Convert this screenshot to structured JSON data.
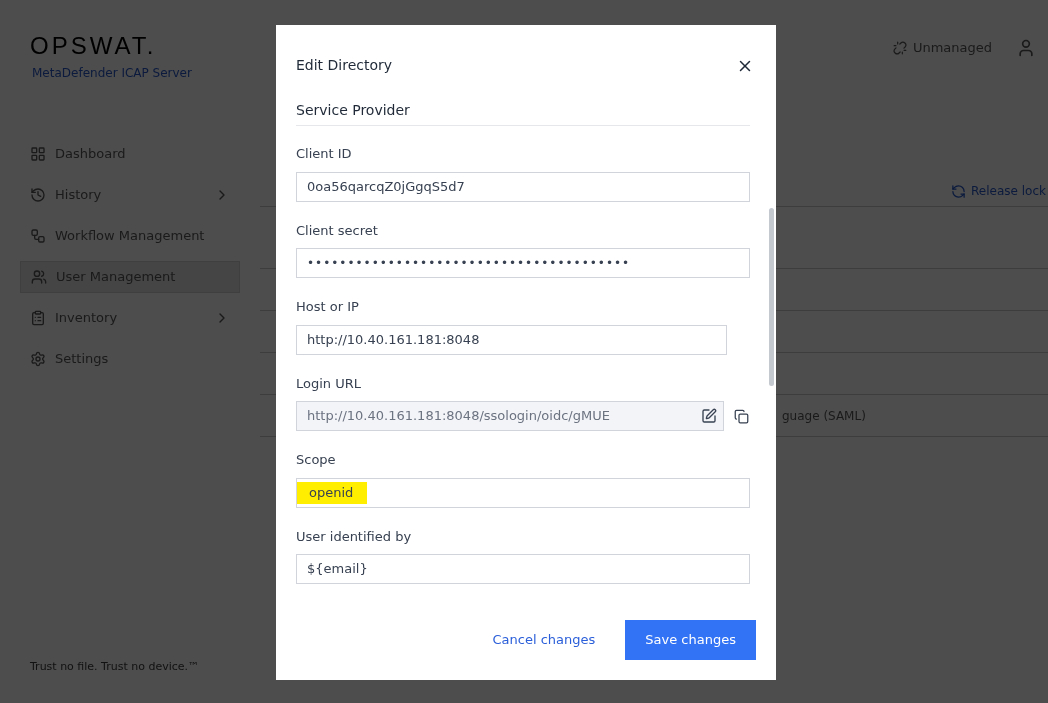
{
  "brand": {
    "logo": "OPSWAT.",
    "product": "MetaDefender ICAP Server"
  },
  "sidebar": {
    "items": [
      {
        "label": "Dashboard",
        "selected": false,
        "has_submenu": false
      },
      {
        "label": "History",
        "selected": false,
        "has_submenu": true
      },
      {
        "label": "Workflow Management",
        "selected": false,
        "has_submenu": false
      },
      {
        "label": "User Management",
        "selected": true,
        "has_submenu": false
      },
      {
        "label": "Inventory",
        "selected": false,
        "has_submenu": true
      },
      {
        "label": "Settings",
        "selected": false,
        "has_submenu": false
      }
    ],
    "footer": "Trust no file. Trust no device.™"
  },
  "header": {
    "status": "Unmanaged"
  },
  "background": {
    "release_lock": "Release lock",
    "rows": [
      "",
      "",
      "",
      "",
      "guage (SAML)"
    ]
  },
  "dialog": {
    "title": "Edit Directory",
    "section": "Service Provider",
    "fields": [
      {
        "kind": "text",
        "label": "Client ID",
        "value": "0oa56qarcqZ0jGgqS5d7",
        "wide": true
      },
      {
        "kind": "secret",
        "label": "Client secret",
        "value": "••••••••••••••••••••••••••••••••••••••••",
        "wide": true
      },
      {
        "kind": "text",
        "label": "Host or IP",
        "value": "http://10.40.161.181:8048",
        "wide": false
      },
      {
        "kind": "readonly",
        "label": "Login URL",
        "value": "http://10.40.161.181:8048/ssologin/oidc/gMUE",
        "wide": false
      },
      {
        "kind": "tags",
        "label": "Scope",
        "tags": [
          {
            "text": "openid",
            "highlighted": true
          }
        ],
        "wide": true
      },
      {
        "kind": "text",
        "label": "User identified by",
        "value": "${email}",
        "wide": true
      }
    ],
    "cancel": "Cancel changes",
    "save": "Save changes"
  }
}
